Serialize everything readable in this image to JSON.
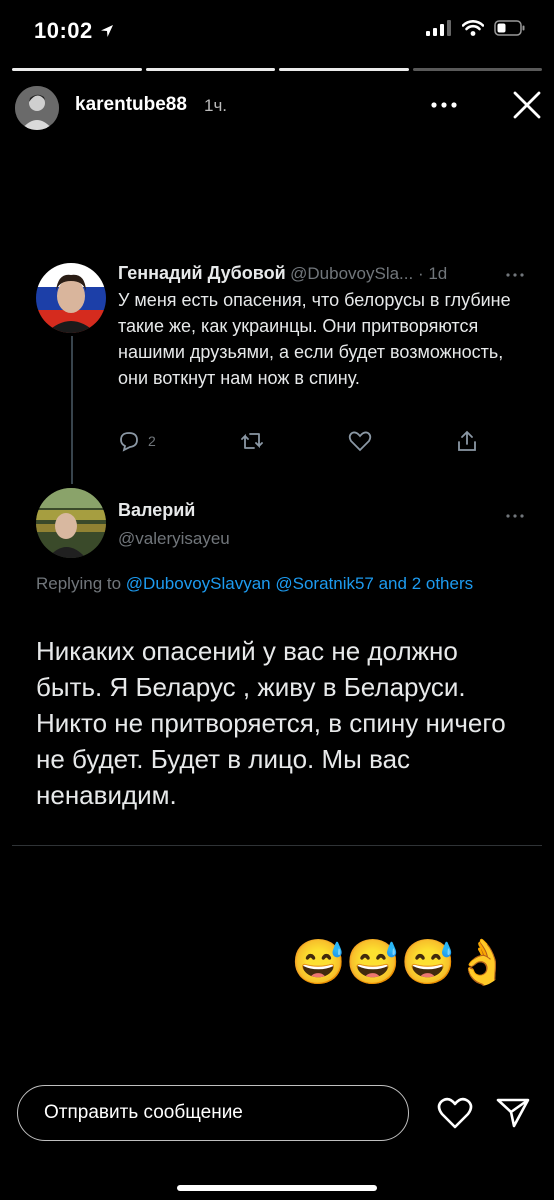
{
  "status_bar": {
    "time": "10:02"
  },
  "story": {
    "username": "karentube88",
    "time_ago": "1ч.",
    "progress": {
      "segments": 4,
      "current_index": 2
    }
  },
  "tweet": {
    "original": {
      "name": "Геннадий Дубовой",
      "handle_time": "@DubovoySla... · 1d",
      "text": "У меня есть опасения, что белорусы в глубине такие же, как украинцы. Они притворяются нашими друзьями, а если будет возможность, они воткнут нам нож в спину.",
      "reply_count": "2"
    },
    "reply": {
      "name": "Валерий",
      "handle": "@valeryisayeu",
      "replying_prefix": "Replying to",
      "replying_links": "@DubovoySlavyan @Soratnik57 and 2 others",
      "text": "Никаких опасений у вас не должно быть. Я Беларус , живу в Беларуси. Никто не притворяется, в спину ничего не будет. Будет в лицо. Мы вас ненавидим."
    }
  },
  "emoji_row": [
    "😅",
    "😅",
    "😅",
    "👌"
  ],
  "bottom_bar": {
    "message_placeholder": "Отправить сообщение"
  },
  "colors": {
    "link": "#1d9bf0",
    "muted": "#71767b",
    "background": "#000000"
  }
}
